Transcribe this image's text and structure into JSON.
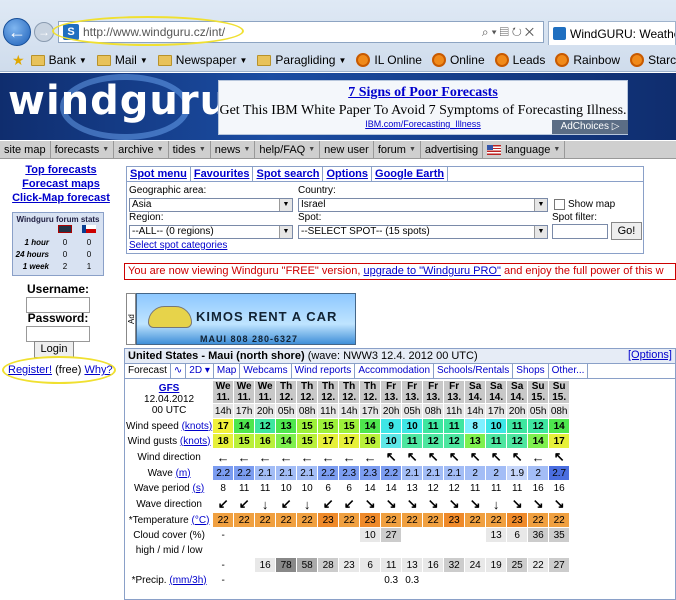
{
  "browser": {
    "url": "http://www.windguru.cz/int/",
    "tab_title": "WindGURU: Weather fo",
    "favorites": [
      {
        "label": "Bank",
        "icon": "folder-icon",
        "dropdown": true
      },
      {
        "label": "Mail",
        "icon": "folder-icon",
        "dropdown": true
      },
      {
        "label": "Newspaper",
        "icon": "folder-icon",
        "dropdown": true
      },
      {
        "label": "Paragliding",
        "icon": "folder-icon",
        "dropdown": true
      },
      {
        "label": "IL Online",
        "icon": "round-icon"
      },
      {
        "label": "Online",
        "icon": "round-icon"
      },
      {
        "label": "Leads",
        "icon": "round-icon"
      },
      {
        "label": "Rainbow",
        "icon": "round-icon"
      },
      {
        "label": "Starcom",
        "icon": "round-icon"
      },
      {
        "label": "Watch",
        "icon": "round-icon"
      }
    ]
  },
  "site": {
    "logo": "windguru",
    "ad": {
      "title": "7 Signs of Poor Forecasts",
      "text": "Get This IBM White Paper To Avoid 7 Symptoms of Forecasting Illness.",
      "url": "IBM.com/Forecasting_Illness",
      "choices": "AdChoices ▷"
    },
    "menu": [
      {
        "label": "site map",
        "dd": false
      },
      {
        "label": "forecasts",
        "dd": true
      },
      {
        "label": "archive",
        "dd": true
      },
      {
        "label": "tides",
        "dd": true
      },
      {
        "label": "news",
        "dd": true
      },
      {
        "label": "help/FAQ",
        "dd": true
      },
      {
        "label": "new user",
        "dd": false
      },
      {
        "label": "forum",
        "dd": true
      },
      {
        "label": "advertising",
        "dd": false
      },
      {
        "label": "language",
        "dd": true
      }
    ]
  },
  "left": {
    "links": [
      "Top forecasts",
      "Forecast maps",
      "Click-Map forecast"
    ],
    "stats_title": "Windguru forum stats",
    "stats": [
      {
        "k": "1 hour",
        "uk": "0",
        "cz": "0"
      },
      {
        "k": "24 hours",
        "uk": "0",
        "cz": "0"
      },
      {
        "k": "1 week",
        "uk": "2",
        "cz": "1"
      }
    ],
    "username_label": "Username:",
    "password_label": "Password:",
    "login_label": "Login",
    "register": "Register!",
    "free": "(free)",
    "why": "Why?"
  },
  "spot": {
    "tabs": [
      "Spot menu",
      "Favourites",
      "Spot search",
      "Options",
      "Google Earth"
    ],
    "area_label": "Geographic area:",
    "area": "Asia",
    "country_label": "Country:",
    "country": "Israel",
    "region_label": "Region:",
    "region": "--ALL-- (0 regions)",
    "spot_label": "Spot:",
    "spot": "--SELECT SPOT-- (15 spots)",
    "filter_label": "Spot filter:",
    "showmap": "Show map",
    "go": "Go!",
    "categories": "Select spot categories"
  },
  "notice": {
    "pre": "You are now viewing Windguru \"FREE\" version, ",
    "link": "upgrade to \"Windguru PRO\"",
    "post": " and enjoy the full power of this w"
  },
  "car_ad": {
    "label": "Ad",
    "title": "KIMOS RENT A CAR",
    "phone": "MAUI 808 280-6327"
  },
  "forecast": {
    "title": "United States - Maui (north shore)",
    "model": "(wave: NWW3 12.4. 2012 00 UTC)",
    "options": "[Options]",
    "tabs": [
      "Forecast",
      "∿",
      "2D ▾",
      "Map",
      "Webcams",
      "Wind reports",
      "Accommodation",
      "Schools/Rentals",
      "Shops",
      "Other..."
    ],
    "gfs": "GFS",
    "gfs_date": "12.04.2012",
    "gfs_utc": "00 UTC",
    "days": [
      "We",
      "We",
      "We",
      "Th",
      "Th",
      "Th",
      "Th",
      "Th",
      "Fr",
      "Fr",
      "Fr",
      "Fr",
      "Sa",
      "Sa",
      "Sa",
      "Su",
      "Su"
    ],
    "dates": [
      "11.",
      "11.",
      "11.",
      "12.",
      "12.",
      "12.",
      "12.",
      "12.",
      "13.",
      "13.",
      "13.",
      "13.",
      "14.",
      "14.",
      "14.",
      "15.",
      "15."
    ],
    "hours": [
      "14h",
      "17h",
      "20h",
      "05h",
      "08h",
      "11h",
      "14h",
      "17h",
      "20h",
      "05h",
      "08h",
      "11h",
      "14h",
      "17h",
      "20h",
      "05h",
      "08h"
    ],
    "rows": [
      {
        "label": "Wind speed",
        "unit": "(knots)",
        "values": [
          "17",
          "14",
          "12",
          "13",
          "15",
          "15",
          "15",
          "14",
          "9",
          "10",
          "11",
          "11",
          "8",
          "10",
          "11",
          "12",
          "14"
        ]
      },
      {
        "label": "Wind gusts",
        "unit": "(knots)",
        "values": [
          "18",
          "15",
          "16",
          "14",
          "15",
          "17",
          "17",
          "16",
          "10",
          "11",
          "12",
          "12",
          "13",
          "11",
          "12",
          "14",
          "17"
        ]
      },
      {
        "label": "Wind direction",
        "arrows": [
          "←",
          "←",
          "←",
          "←",
          "←",
          "←",
          "←",
          "←",
          "↖",
          "↖",
          "↖",
          "↖",
          "↖",
          "↖",
          "↖",
          "←",
          "↖"
        ]
      },
      {
        "label": "Wave",
        "unit": "(m)",
        "values": [
          "2.2",
          "2.2",
          "2.1",
          "2.1",
          "2.1",
          "2.2",
          "2.3",
          "2.3",
          "2.2",
          "2.1",
          "2.1",
          "2.1",
          "2",
          "2",
          "1.9",
          "2",
          "2.7"
        ]
      },
      {
        "label": "Wave period",
        "unit": "(s)",
        "values": [
          "8",
          "11",
          "11",
          "10",
          "10",
          "6",
          "6",
          "14",
          "14",
          "13",
          "12",
          "12",
          "11",
          "11",
          "11",
          "16",
          "16"
        ]
      },
      {
        "label": "Wave direction",
        "arrows": [
          "↙",
          "↙",
          "↓",
          "↙",
          "↓",
          "↙",
          "↙",
          "↘",
          "↘",
          "↘",
          "↘",
          "↘",
          "↘",
          "↓",
          "↘",
          "↘",
          "↘"
        ]
      },
      {
        "label": "*Temperature",
        "unit": "(°C)",
        "values": [
          "22",
          "22",
          "22",
          "22",
          "22",
          "23",
          "22",
          "23",
          "22",
          "22",
          "22",
          "23",
          "22",
          "22",
          "23",
          "22",
          "22"
        ]
      },
      {
        "label": "Cloud cover (%)",
        "values": [
          "-",
          "",
          "",
          "",
          "",
          "",
          "",
          "10",
          "27",
          "",
          "",
          "",
          "",
          "13",
          "6",
          "36",
          "35"
        ]
      },
      {
        "label": "high / mid / low",
        "values": [
          "",
          "",
          "",
          "",
          "",
          "",
          "",
          "",
          "",
          "",
          "",
          "",
          "",
          "",
          "",
          "",
          ""
        ]
      },
      {
        "label": "",
        "values": [
          "-",
          "",
          "16",
          "78",
          "58",
          "28",
          "23",
          "6",
          "11",
          "13",
          "16",
          "32",
          "24",
          "19",
          "25",
          "22",
          "27"
        ]
      },
      {
        "label": "*Precip.",
        "unit": "(mm/3h)",
        "values": [
          "-",
          "",
          "",
          "",
          "",
          "",
          "",
          "",
          "0.3",
          "0.3",
          "",
          "",
          "",
          "",
          "",
          "",
          ""
        ]
      }
    ]
  }
}
